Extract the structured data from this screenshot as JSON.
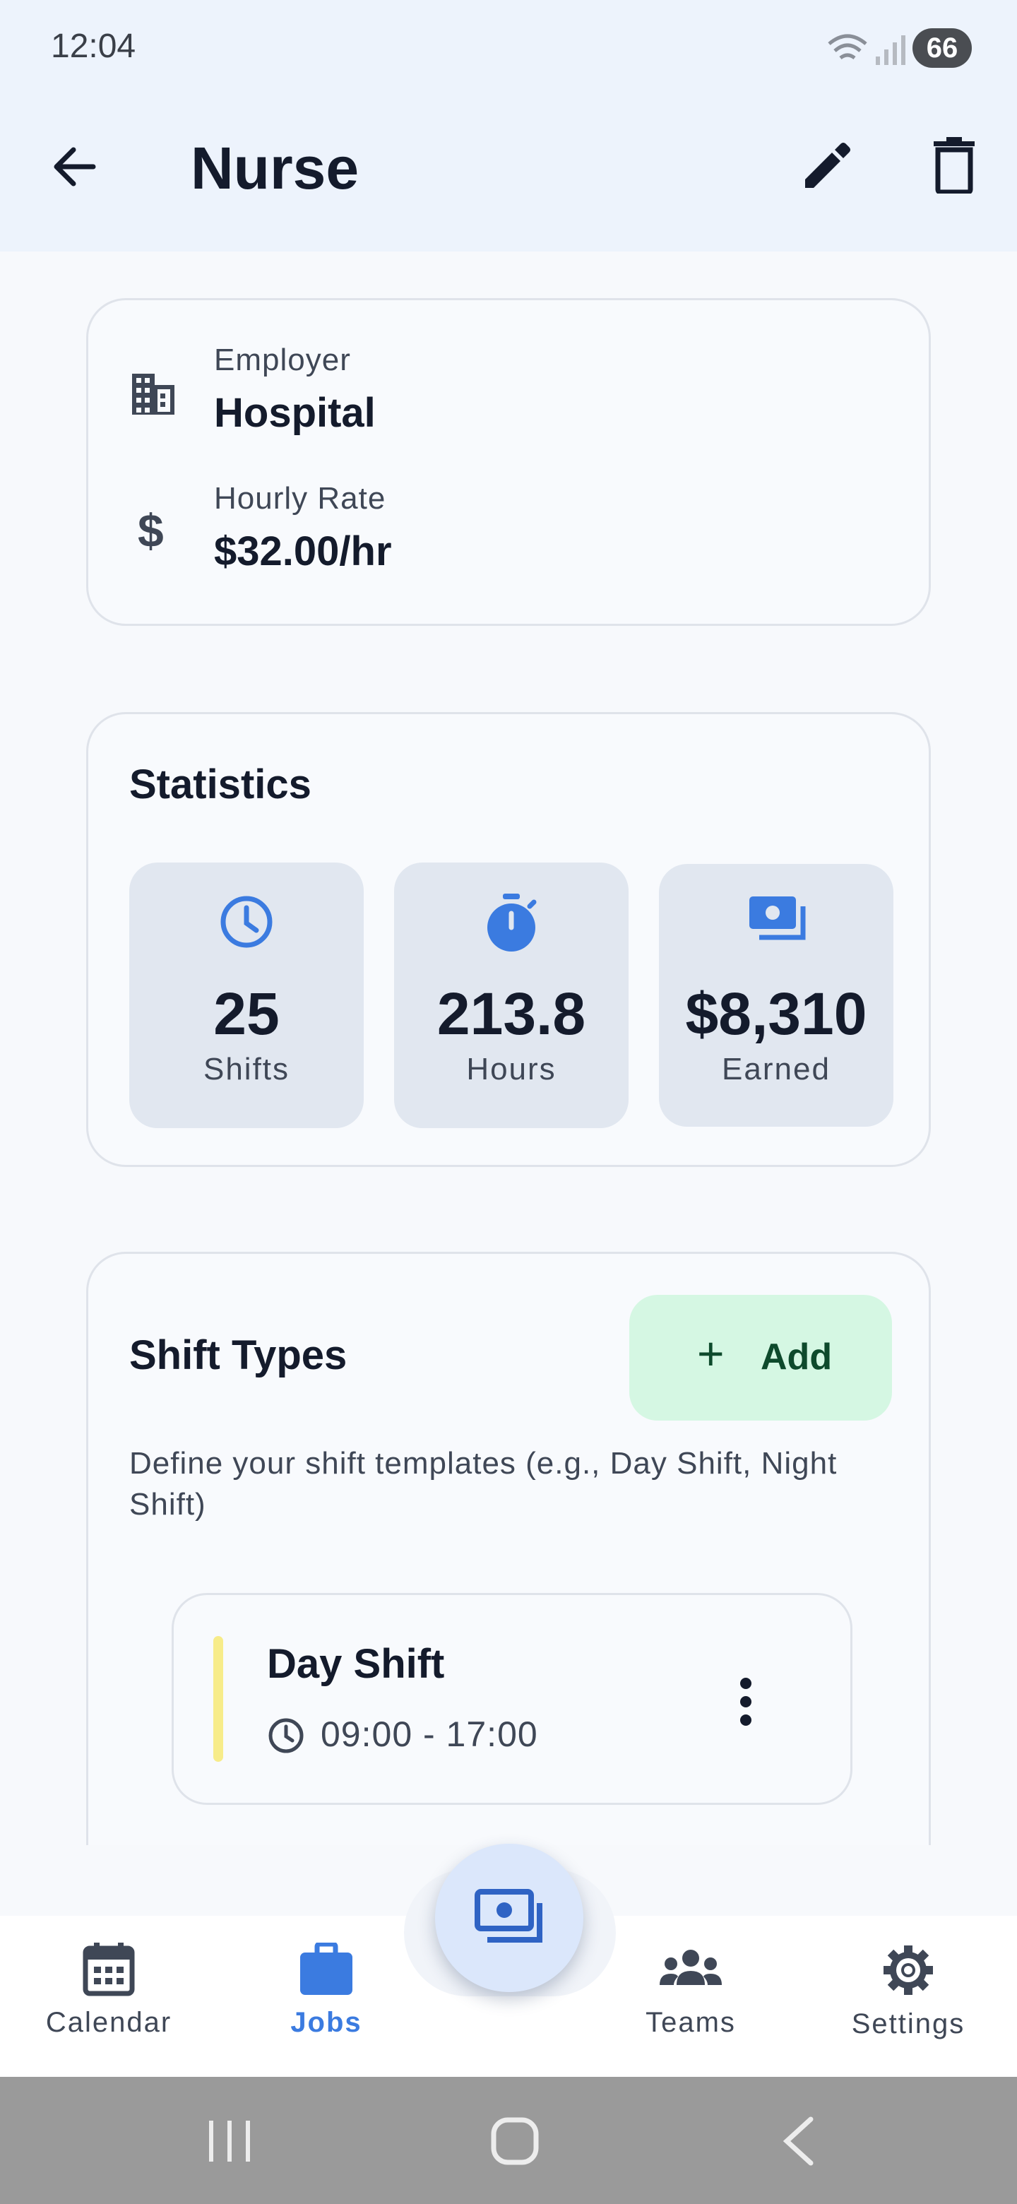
{
  "status_bar": {
    "time": "12:04",
    "battery": "66"
  },
  "app_bar": {
    "title": "Nurse"
  },
  "job_info": {
    "employer_label": "Employer",
    "employer_value": "Hospital",
    "rate_label": "Hourly Rate",
    "rate_value": "$32.00/hr"
  },
  "statistics": {
    "title": "Statistics",
    "items": [
      {
        "value": "25",
        "label": "Shifts",
        "icon": "clock-icon"
      },
      {
        "value": "213.8",
        "label": "Hours",
        "icon": "timer-icon"
      },
      {
        "value": "$8,310",
        "label": "Earned",
        "icon": "money-icon"
      }
    ]
  },
  "shift_types": {
    "title": "Shift Types",
    "add_label": "Add",
    "description": "Define your shift templates (e.g., Day Shift, Night Shift)",
    "items": [
      {
        "name": "Day Shift",
        "time": "09:00 - 17:00",
        "color": "#f7ec8a"
      }
    ]
  },
  "bottom_nav": {
    "items": [
      {
        "label": "Calendar",
        "icon": "calendar-icon"
      },
      {
        "label": "Jobs",
        "icon": "briefcase-icon"
      },
      {
        "label": "Teams",
        "icon": "people-icon"
      },
      {
        "label": "Settings",
        "icon": "gear-icon"
      }
    ]
  },
  "colors": {
    "accent": "#3b7be0",
    "add_bg": "#d5f7e3",
    "add_fg": "#0e4a2c"
  }
}
